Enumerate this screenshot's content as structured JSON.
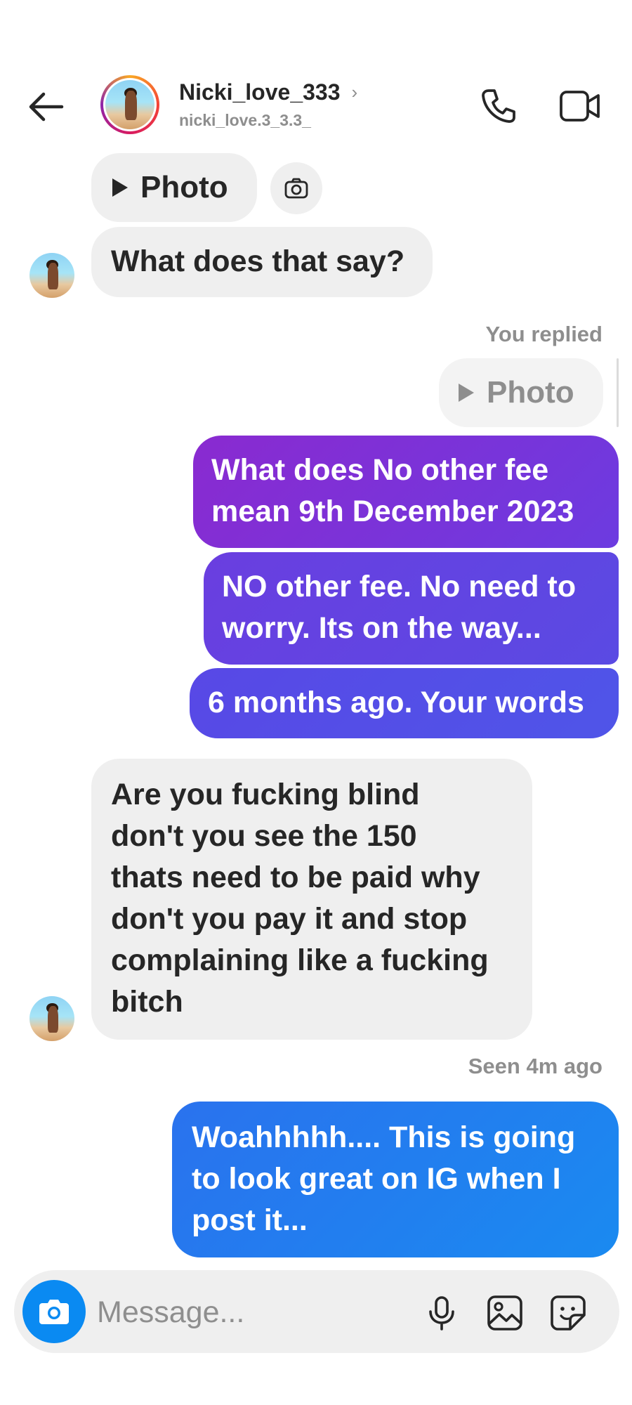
{
  "header": {
    "display_name": "Nicki_love_333",
    "username": "nicki_love.3_3.3_",
    "chevron": "›",
    "icons": {
      "back": "back-arrow-icon",
      "call": "phone-icon",
      "video": "video-camera-icon"
    }
  },
  "messages": {
    "m1_photo_label": "Photo",
    "m2_text": "What does that say?",
    "replied_label": "You replied",
    "m3_photo_label": "Photo",
    "m4_text_line1": "What does No other fee",
    "m4_text_line2": "mean 9th December 2023",
    "m5_text_line1": "NO other fee. No need to",
    "m5_text_line2": "worry. Its on the way...",
    "m6_text": "6 months ago. Your words",
    "m7_lines": [
      "Are you fucking blind",
      "don't you see the 150",
      "thats need to be paid why",
      "don't you pay it and stop",
      "complaining like a fucking",
      "bitch"
    ],
    "seen_label": "Seen 4m ago",
    "m8_lines": [
      "Woahhhhh.... This is going",
      "to look great on IG when I",
      "post it..."
    ]
  },
  "composer": {
    "placeholder": "Message...",
    "icons": {
      "camera": "camera-icon",
      "mic": "microphone-icon",
      "gallery": "image-icon",
      "sticker": "sticker-icon"
    }
  },
  "colors": {
    "bubble_purple": "#7b2fd6",
    "bubble_violet": "#5b45e0",
    "bubble_blue": "#1f7cf0",
    "incoming_bg": "#efefef",
    "accent_blue": "#0a8af2"
  }
}
